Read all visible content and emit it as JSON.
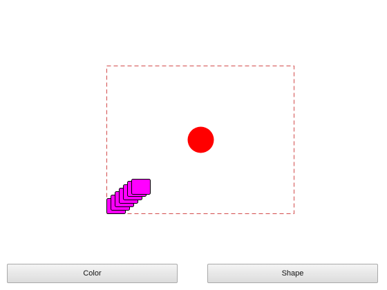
{
  "buttons": {
    "color_label": "Color",
    "shape_label": "Shape"
  },
  "colors": {
    "bounds_stroke": "#d24a4a",
    "ball_fill": "#ff0000",
    "square_fill": "#ff00ff",
    "square_stroke": "#000000"
  },
  "shapes": {
    "ball": "circle",
    "trail": "rounded-square",
    "trail_count": 6
  }
}
